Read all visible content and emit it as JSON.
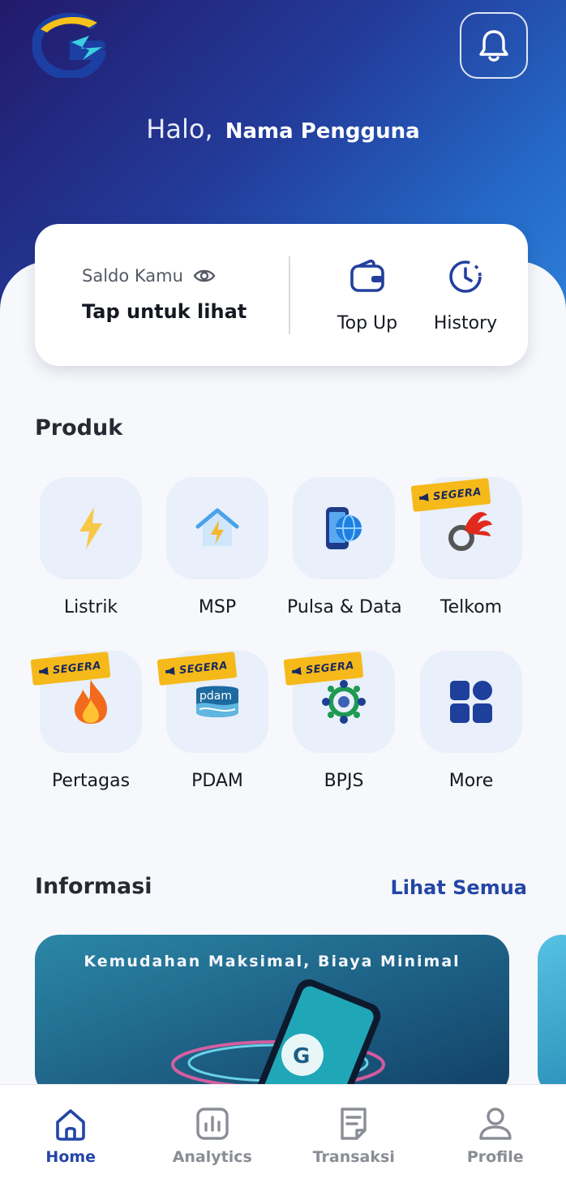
{
  "header": {
    "greeting_prefix": "Halo,",
    "user_name": "Nama Pengguna",
    "accent_color": "#2346a6"
  },
  "balance_card": {
    "saldo_label": "Saldo Kamu",
    "saldo_value": "Tap untuk lihat",
    "actions": [
      {
        "label": "Top Up",
        "icon": "wallet-icon"
      },
      {
        "label": "History",
        "icon": "history-clock-icon"
      }
    ]
  },
  "produk": {
    "title": "Produk",
    "badge_label": "SEGERA",
    "items": [
      {
        "label": "Listrik",
        "icon": "lightning-icon",
        "coming_soon": false
      },
      {
        "label": "MSP",
        "icon": "house-lightning-icon",
        "coming_soon": false
      },
      {
        "label": "Pulsa & Data",
        "icon": "phone-globe-icon",
        "coming_soon": false
      },
      {
        "label": "Telkom",
        "icon": "telkom-logo-icon",
        "coming_soon": true
      },
      {
        "label": "Pertagas",
        "icon": "flame-icon",
        "coming_soon": true
      },
      {
        "label": "PDAM",
        "icon": "pdam-logo-icon",
        "coming_soon": true
      },
      {
        "label": "BPJS",
        "icon": "bpjs-logo-icon",
        "coming_soon": true
      },
      {
        "label": "More",
        "icon": "grid-more-icon",
        "coming_soon": false
      }
    ]
  },
  "informasi": {
    "title": "Informasi",
    "see_all": "Lihat Semua",
    "banner_text": "Kemudahan Maksimal, Biaya Minimal"
  },
  "bottom_nav": {
    "items": [
      {
        "label": "Home",
        "icon": "home-icon",
        "active": true
      },
      {
        "label": "Analytics",
        "icon": "analytics-icon",
        "active": false
      },
      {
        "label": "Transaksi",
        "icon": "transaction-icon",
        "active": false
      },
      {
        "label": "Profile",
        "icon": "profile-icon",
        "active": false
      }
    ]
  }
}
